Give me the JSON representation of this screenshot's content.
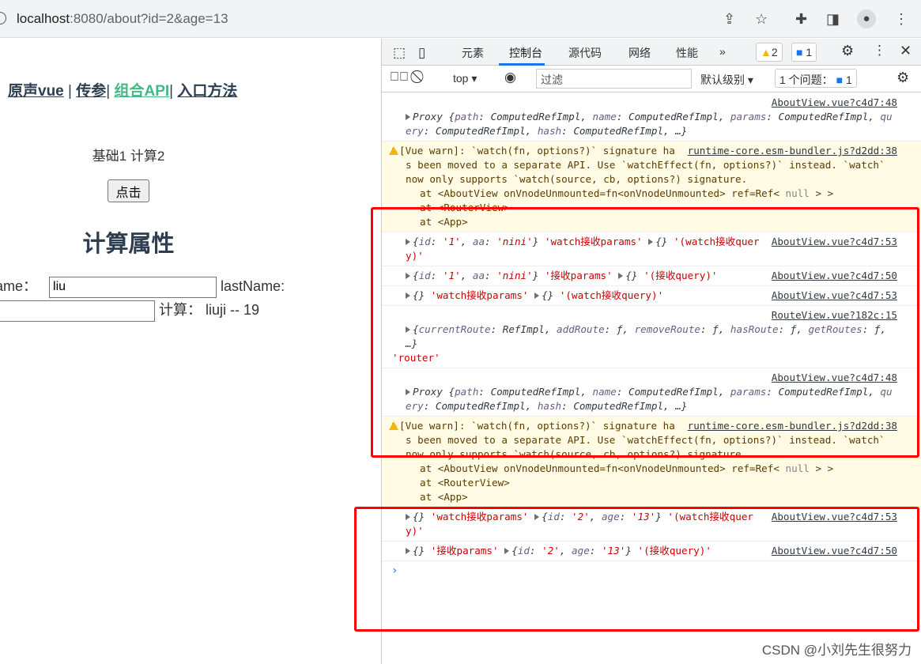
{
  "browser": {
    "url_host": "localhost",
    "url_rest": ":8080/about?id=2&age=13",
    "icons": [
      "share-icon",
      "star-icon",
      "extensions-icon",
      "sidepanel-icon",
      "profile-icon",
      "menu-icon"
    ]
  },
  "page": {
    "nav": [
      {
        "label": "原声vue"
      },
      {
        "sep": " | "
      },
      {
        "label": "传参"
      },
      {
        "sep": "| "
      },
      {
        "label": "组合API",
        "active": true
      },
      {
        "sep": "| "
      },
      {
        "label": "入口方法"
      }
    ],
    "nav_sep1": " | ",
    "nav_sep2": "| ",
    "nav_sep3": "| ",
    "counts": "基础1 计算2",
    "button": "点击",
    "heading": "计算属性",
    "first_label": "ame：",
    "first_value": "liu",
    "last_label": "lastName:",
    "last_value": "",
    "computed_label": "计算：",
    "computed_value": "liuji -- 19",
    "active_color": "#42b983"
  },
  "devtools": {
    "tabs": [
      "元素",
      "控制台",
      "源代码",
      "网络",
      "性能"
    ],
    "selected_tab": "控制台",
    "more": "»",
    "warn_count": "2",
    "info_count": "1",
    "context": "top",
    "filter_placeholder": "过滤",
    "level": "默认级别",
    "issues_label": "1 个问题：",
    "issues_count": "1",
    "rows": [
      {
        "src": "AboutView.vue?c4d7:48",
        "src_own": true,
        "tokens": [
          [
            "v",
            "Proxy {"
          ],
          [
            "k",
            "path"
          ],
          [
            "v",
            ": ComputedRefImpl, "
          ],
          [
            "k",
            "name"
          ],
          [
            "v",
            ": ComputedRefImpl, "
          ],
          [
            "k",
            "params"
          ],
          [
            "v",
            ": ComputedRefImpl, "
          ],
          [
            "k",
            "query"
          ],
          [
            "v",
            ": ComputedRefImpl, "
          ],
          [
            "k",
            "hash"
          ],
          [
            "v",
            ": ComputedRefImpl, …}"
          ]
        ]
      },
      {
        "warn": true,
        "src": "runtime-core.esm-bundler.js?d2dd:38",
        "tokens": [
          [
            "",
            "[Vue warn]: `watch(fn, options?)` signature has been moved to a separate API. Use `watchEffect(fn, options?)` instead. `watch` now only supports `watch(source, cb, options?) signature."
          ]
        ],
        "stack": [
          [
            [
              "",
              "at <AboutView onVnodeUnmounted=fn<onVnodeUnmounted> ref=Ref< "
            ],
            [
              "g",
              "null"
            ],
            [
              "",
              " > >"
            ]
          ],
          [
            [
              "",
              "at <RouterView>"
            ]
          ],
          [
            [
              "",
              "at <App>"
            ]
          ]
        ]
      },
      {
        "src": "AboutView.vue?c4d7:53",
        "tokens": [
          [
            "v",
            "{"
          ],
          [
            "k",
            "id"
          ],
          [
            "v",
            ": "
          ],
          [
            "si",
            "'1'"
          ],
          [
            "v",
            ", "
          ],
          [
            "k",
            "aa"
          ],
          [
            "v",
            ": "
          ],
          [
            "si",
            "'nini'"
          ],
          [
            "v",
            "} "
          ],
          [
            "s",
            "'watch接收params' "
          ],
          [
            "tri",
            ""
          ],
          [
            "v",
            "{} "
          ],
          [
            "s",
            "'(watch接收query)'"
          ]
        ]
      },
      {
        "src": "AboutView.vue?c4d7:50",
        "tokens": [
          [
            "v",
            "{"
          ],
          [
            "k",
            "id"
          ],
          [
            "v",
            ": "
          ],
          [
            "si",
            "'1'"
          ],
          [
            "v",
            ", "
          ],
          [
            "k",
            "aa"
          ],
          [
            "v",
            ": "
          ],
          [
            "si",
            "'nini'"
          ],
          [
            "v",
            "} "
          ],
          [
            "s",
            "'接收params' "
          ],
          [
            "tri",
            ""
          ],
          [
            "v",
            "{} "
          ],
          [
            "s",
            "'(接收query)'"
          ]
        ]
      },
      {
        "src": "AboutView.vue?c4d7:53",
        "tokens": [
          [
            "v",
            "{} "
          ],
          [
            "s",
            "'watch接收params' "
          ],
          [
            "tri",
            ""
          ],
          [
            "v",
            "{} "
          ],
          [
            "s",
            "'(watch接收query)'"
          ]
        ]
      },
      {
        "src": "RouteView.vue?182c:15",
        "src_own": true,
        "tokens": [
          [
            "v",
            "{"
          ],
          [
            "k",
            "currentRoute"
          ],
          [
            "v",
            ": RefImpl, "
          ],
          [
            "k",
            "addRoute"
          ],
          [
            "v",
            ": ƒ, "
          ],
          [
            "k",
            "removeRoute"
          ],
          [
            "v",
            ": ƒ, "
          ],
          [
            "k",
            "hasRoute"
          ],
          [
            "v",
            ": ƒ, "
          ],
          [
            "k",
            "getRoutes"
          ],
          [
            "v",
            ": ƒ, …}"
          ]
        ],
        "after": "'router'"
      },
      {
        "src": "AboutView.vue?c4d7:48",
        "src_own": true,
        "tokens": [
          [
            "v",
            "Proxy {"
          ],
          [
            "k",
            "path"
          ],
          [
            "v",
            ": ComputedRefImpl, "
          ],
          [
            "k",
            "name"
          ],
          [
            "v",
            ": ComputedRefImpl, "
          ],
          [
            "k",
            "params"
          ],
          [
            "v",
            ": ComputedRefImpl, "
          ],
          [
            "k",
            "query"
          ],
          [
            "v",
            ": ComputedRefImpl, "
          ],
          [
            "k",
            "hash"
          ],
          [
            "v",
            ": ComputedRefImpl, …}"
          ]
        ]
      },
      {
        "warn": true,
        "src": "runtime-core.esm-bundler.js?d2dd:38",
        "tokens": [
          [
            "",
            "[Vue warn]: `watch(fn, options?)` signature has been moved to a separate API. Use `watchEffect(fn, options?)` instead. `watch` now only supports `watch(source, cb, options?) signature."
          ]
        ],
        "stack": [
          [
            [
              "",
              "at <AboutView onVnodeUnmounted=fn<onVnodeUnmounted> ref=Ref< "
            ],
            [
              "g",
              "null"
            ],
            [
              "",
              " > >"
            ]
          ],
          [
            [
              "",
              "at <RouterView>"
            ]
          ],
          [
            [
              "",
              "at <App>"
            ]
          ]
        ]
      },
      {
        "src": "AboutView.vue?c4d7:53",
        "tokens": [
          [
            "v",
            "{} "
          ],
          [
            "s",
            "'watch接收params' "
          ],
          [
            "tri",
            ""
          ],
          [
            "v",
            "{"
          ],
          [
            "k",
            "id"
          ],
          [
            "v",
            ": "
          ],
          [
            "si",
            "'2'"
          ],
          [
            "v",
            ", "
          ],
          [
            "k",
            "age"
          ],
          [
            "v",
            ": "
          ],
          [
            "si",
            "'13'"
          ],
          [
            "v",
            "} "
          ],
          [
            "s",
            "'(watch接收query)'"
          ]
        ]
      },
      {
        "src": "AboutView.vue?c4d7:50",
        "tokens": [
          [
            "v",
            "{} "
          ],
          [
            "s",
            "'接收params' "
          ],
          [
            "tri",
            ""
          ],
          [
            "v",
            "{"
          ],
          [
            "k",
            "id"
          ],
          [
            "v",
            ": "
          ],
          [
            "si",
            "'2'"
          ],
          [
            "v",
            ", "
          ],
          [
            "k",
            "age"
          ],
          [
            "v",
            ": "
          ],
          [
            "si",
            "'13'"
          ],
          [
            "v",
            "} "
          ],
          [
            "s",
            "'(接收query)'"
          ]
        ]
      }
    ],
    "prompt": "›"
  },
  "annotation_color": "#ff0000",
  "watermark": "CSDN @小刘先生很努力"
}
